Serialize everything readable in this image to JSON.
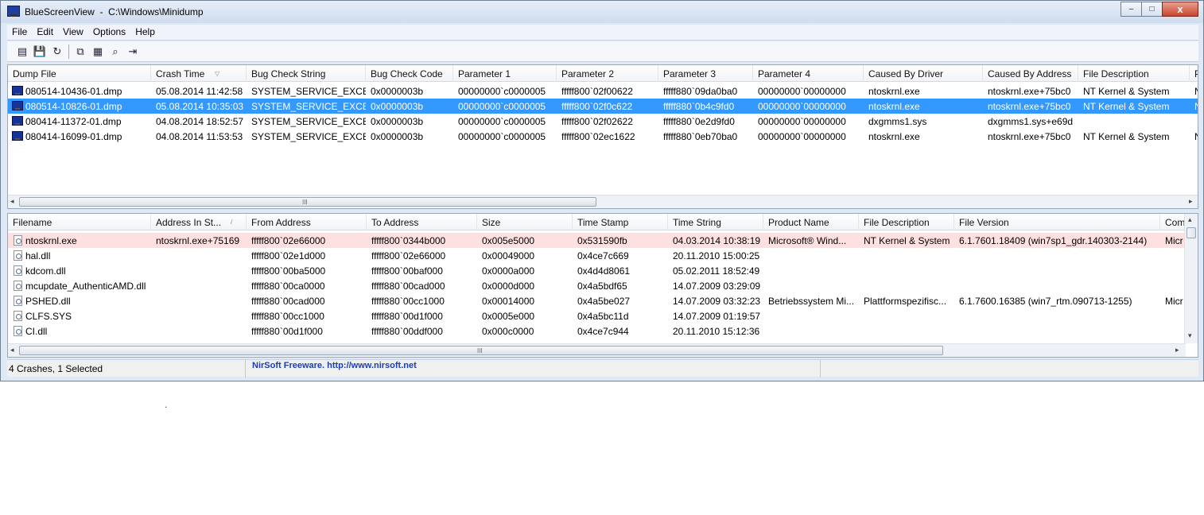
{
  "window": {
    "title": "BlueScreenView  -  C:\\Windows\\Minidump",
    "minimize_glyph": "–",
    "maximize_glyph": "□",
    "close_glyph": "x"
  },
  "menu": [
    "File",
    "Edit",
    "View",
    "Options",
    "Help"
  ],
  "toolbar": [
    {
      "icon": "properties-icon",
      "glyph": "▤"
    },
    {
      "icon": "save-icon",
      "glyph": "💾"
    },
    {
      "icon": "refresh-icon",
      "glyph": "↻"
    },
    {
      "icon": "copy-icon",
      "glyph": "⧉"
    },
    {
      "icon": "html-report-icon",
      "glyph": "▦"
    },
    {
      "icon": "find-icon",
      "glyph": "⌕"
    },
    {
      "icon": "exit-icon",
      "glyph": "⇥"
    }
  ],
  "crash_list": {
    "columns": [
      "Dump File",
      "Crash Time",
      "Bug Check String",
      "Bug Check Code",
      "Parameter 1",
      "Parameter 2",
      "Parameter 3",
      "Parameter 4",
      "Caused By Driver",
      "Caused By Address",
      "File Description",
      "P"
    ],
    "sort_glyph": "▽",
    "rows": [
      [
        "080514-10436-01.dmp",
        "05.08.2014 11:42:58",
        "SYSTEM_SERVICE_EXCE...",
        "0x0000003b",
        "00000000`c0000005",
        "fffff800`02f00622",
        "fffff880`09da0ba0",
        "00000000`00000000",
        "ntoskrnl.exe",
        "ntoskrnl.exe+75bc0",
        "NT Kernel & System",
        "N"
      ],
      [
        "080514-10826-01.dmp",
        "05.08.2014 10:35:03",
        "SYSTEM_SERVICE_EXCE...",
        "0x0000003b",
        "00000000`c0000005",
        "fffff800`02f0c622",
        "fffff880`0b4c9fd0",
        "00000000`00000000",
        "ntoskrnl.exe",
        "ntoskrnl.exe+75bc0",
        "NT Kernel & System",
        "N"
      ],
      [
        "080414-11372-01.dmp",
        "04.08.2014 18:52:57",
        "SYSTEM_SERVICE_EXCE...",
        "0x0000003b",
        "00000000`c0000005",
        "fffff800`02f02622",
        "fffff880`0e2d9fd0",
        "00000000`00000000",
        "dxgmms1.sys",
        "dxgmms1.sys+e69d",
        "",
        ""
      ],
      [
        "080414-16099-01.dmp",
        "04.08.2014 11:53:53",
        "SYSTEM_SERVICE_EXCE...",
        "0x0000003b",
        "00000000`c0000005",
        "fffff800`02ec1622",
        "fffff880`0eb70ba0",
        "00000000`00000000",
        "ntoskrnl.exe",
        "ntoskrnl.exe+75bc0",
        "NT Kernel & System",
        "N"
      ]
    ],
    "selected_index": 1
  },
  "driver_list": {
    "columns": [
      "Filename",
      "Address In St...",
      "From Address",
      "To Address",
      "Size",
      "Time Stamp",
      "Time String",
      "Product Name",
      "File Description",
      "File Version",
      "Com"
    ],
    "sort_glyph": "/",
    "rows": [
      [
        "ntoskrnl.exe",
        "ntoskrnl.exe+75169",
        "fffff800`02e66000",
        "fffff800`0344b000",
        "0x005e5000",
        "0x531590fb",
        "04.03.2014 10:38:19",
        "Microsoft® Wind...",
        "NT Kernel & System",
        "6.1.7601.18409 (win7sp1_gdr.140303-2144)",
        "Micr"
      ],
      [
        "hal.dll",
        "",
        "fffff800`02e1d000",
        "fffff800`02e66000",
        "0x00049000",
        "0x4ce7c669",
        "20.11.2010 15:00:25",
        "",
        "",
        "",
        ""
      ],
      [
        "kdcom.dll",
        "",
        "fffff800`00ba5000",
        "fffff800`00baf000",
        "0x0000a000",
        "0x4d4d8061",
        "05.02.2011 18:52:49",
        "",
        "",
        "",
        ""
      ],
      [
        "mcupdate_AuthenticAMD.dll",
        "",
        "fffff880`00ca0000",
        "fffff880`00cad000",
        "0x0000d000",
        "0x4a5bdf65",
        "14.07.2009 03:29:09",
        "",
        "",
        "",
        ""
      ],
      [
        "PSHED.dll",
        "",
        "fffff880`00cad000",
        "fffff880`00cc1000",
        "0x00014000",
        "0x4a5be027",
        "14.07.2009 03:32:23",
        "Betriebssystem Mi...",
        "Plattformspezifisc...",
        "6.1.7600.16385 (win7_rtm.090713-1255)",
        "Micr"
      ],
      [
        "CLFS.SYS",
        "",
        "fffff880`00cc1000",
        "fffff880`00d1f000",
        "0x0005e000",
        "0x4a5bc11d",
        "14.07.2009 01:19:57",
        "",
        "",
        "",
        ""
      ],
      [
        "CI.dll",
        "",
        "fffff880`00d1f000",
        "fffff880`00ddf000",
        "0x000c0000",
        "0x4ce7c944",
        "20.11.2010 15:12:36",
        "",
        "",
        "",
        ""
      ]
    ],
    "highlight_index": 0
  },
  "scroll": {
    "left_glyph": "◂",
    "right_glyph": "▸",
    "up_glyph": "▴",
    "down_glyph": "▾",
    "grip_glyph": "III"
  },
  "status": {
    "summary": "4 Crashes, 1 Selected",
    "link": "NirSoft Freeware.  http://www.nirsoft.net"
  },
  "stray_text": "."
}
